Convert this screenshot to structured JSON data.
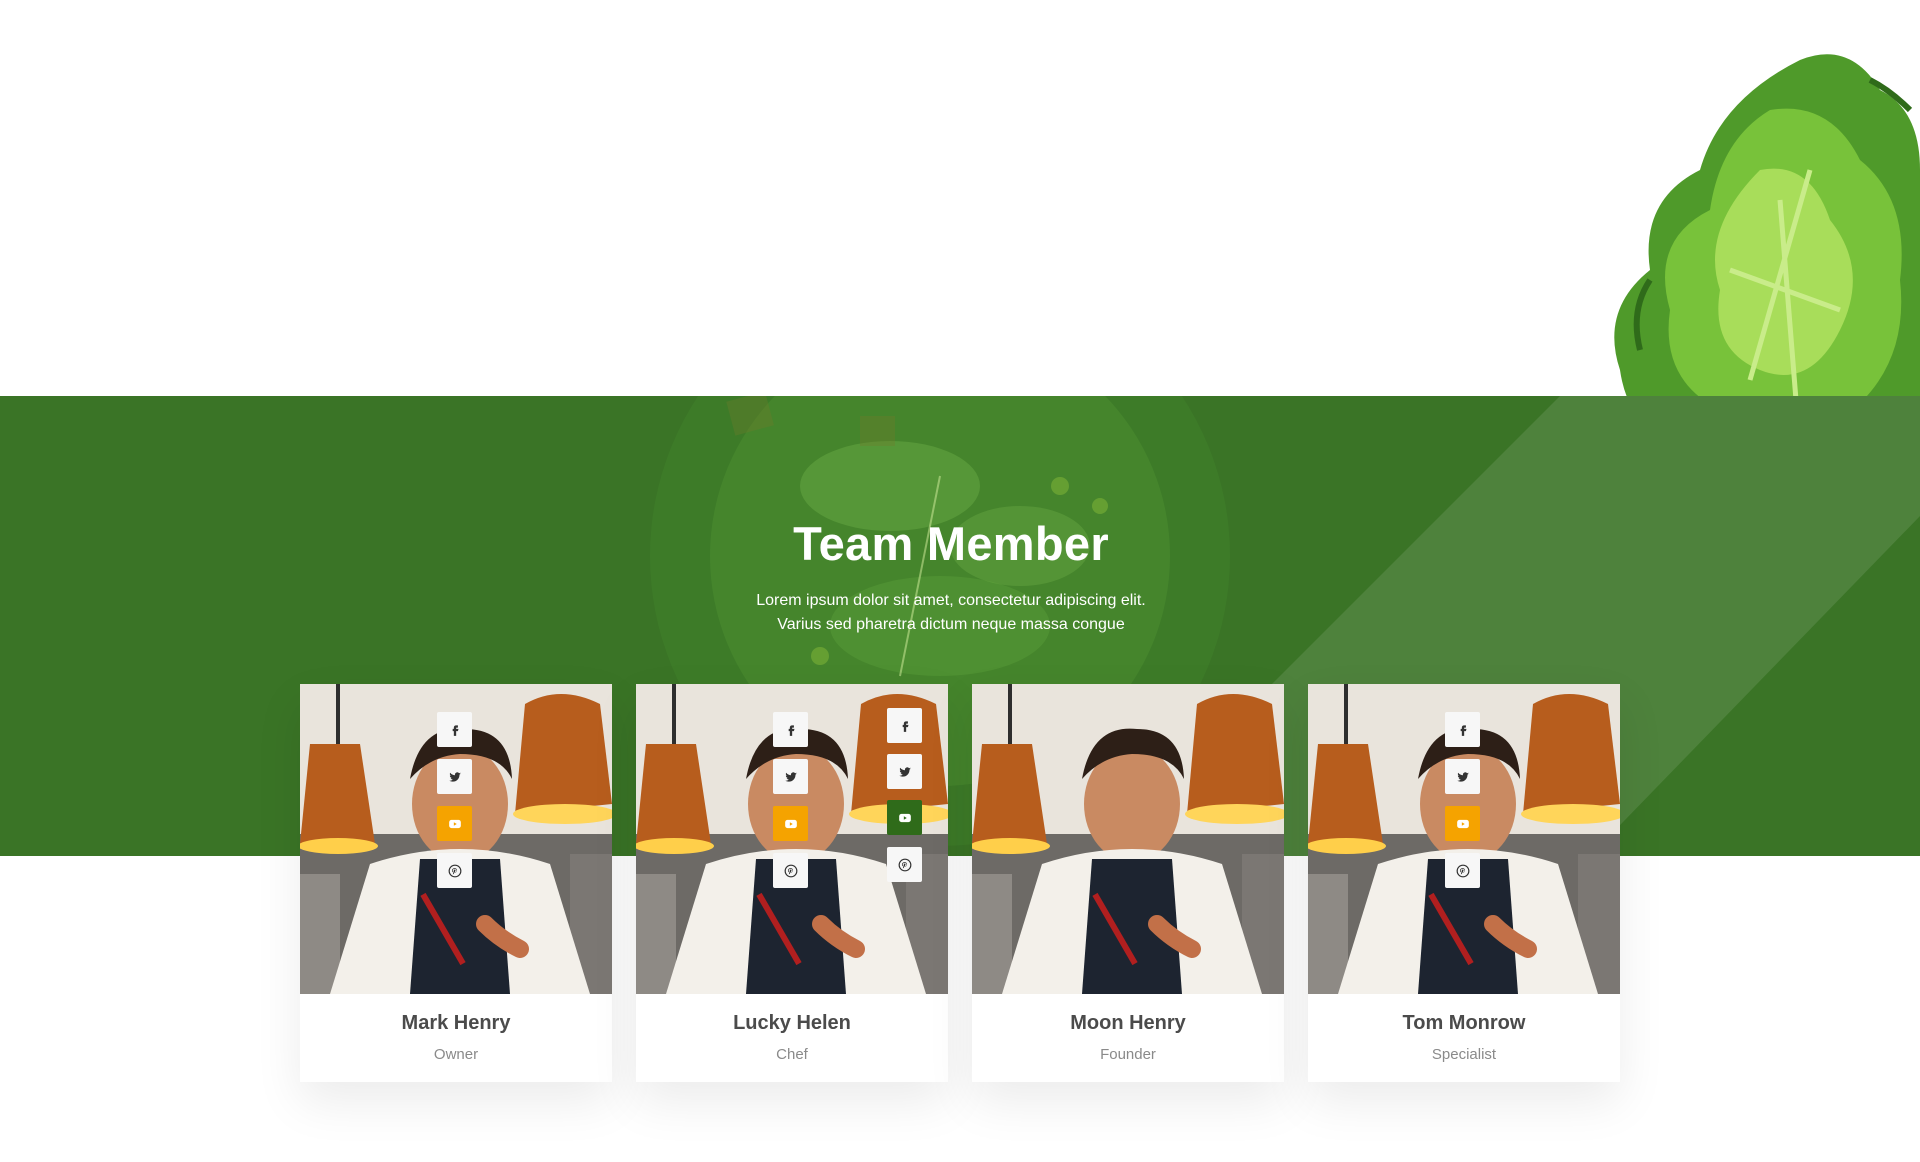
{
  "section": {
    "title": "Team Member",
    "subtitle_line1": "Lorem ipsum dolor sit amet, consectetur adipiscing elit.",
    "subtitle_line2": "Varius sed pharetra dictum neque massa congue"
  },
  "team": [
    {
      "name": "Mark Henry",
      "role": "Owner"
    },
    {
      "name": "Lucky Helen",
      "role": "Chef"
    },
    {
      "name": "Moon Henry",
      "role": "Founder"
    },
    {
      "name": "Tom Monrow",
      "role": "Specialist"
    }
  ],
  "social_icons": [
    "facebook-icon",
    "twitter-icon",
    "youtube-icon",
    "pinterest-icon"
  ],
  "colors": {
    "band_green": "#3a7426",
    "youtube_accent": "#f5a300",
    "youtube_hover": "#2f6b1a",
    "name_text": "#4b4b4b",
    "role_text": "#8a8a8a"
  }
}
